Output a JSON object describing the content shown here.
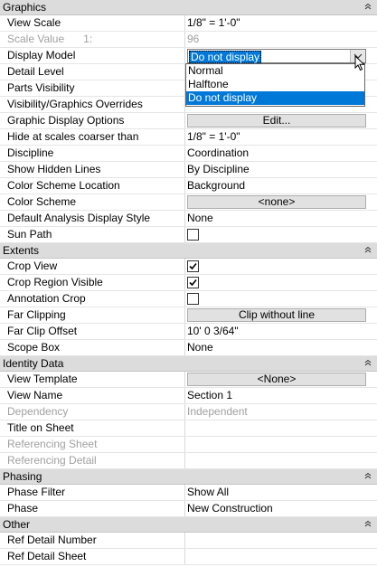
{
  "sections": [
    {
      "title": "Graphics",
      "rows": [
        {
          "name": "View Scale",
          "value": "1/8\" = 1'-0\""
        },
        {
          "name": "Scale Value",
          "extra": "1:",
          "value": "96",
          "disabled": true
        },
        {
          "name": "Display Model",
          "type": "combo",
          "value": "Do not display"
        },
        {
          "name": "Detail Level",
          "value": ""
        },
        {
          "name": "Parts Visibility",
          "value": ""
        },
        {
          "name": "Visibility/Graphics Overrides",
          "value": ""
        },
        {
          "name": "Graphic Display Options",
          "type": "button",
          "value": "Edit..."
        },
        {
          "name": "Hide at scales coarser than",
          "value": "1/8\" = 1'-0\""
        },
        {
          "name": "Discipline",
          "value": "Coordination"
        },
        {
          "name": "Show Hidden Lines",
          "value": "By Discipline"
        },
        {
          "name": "Color Scheme Location",
          "value": "Background"
        },
        {
          "name": "Color Scheme",
          "type": "button",
          "value": "<none>"
        },
        {
          "name": "Default Analysis Display Style",
          "value": "None"
        },
        {
          "name": "Sun Path",
          "type": "checkbox",
          "checked": false
        }
      ]
    },
    {
      "title": "Extents",
      "rows": [
        {
          "name": "Crop View",
          "type": "checkbox",
          "checked": true
        },
        {
          "name": "Crop Region Visible",
          "type": "checkbox",
          "checked": true
        },
        {
          "name": "Annotation Crop",
          "type": "checkbox",
          "checked": false
        },
        {
          "name": "Far Clipping",
          "type": "button",
          "value": "Clip without line"
        },
        {
          "name": "Far Clip Offset",
          "value": "10'  0 3/64\""
        },
        {
          "name": "Scope Box",
          "value": "None"
        }
      ]
    },
    {
      "title": "Identity Data",
      "rows": [
        {
          "name": "View Template",
          "type": "button",
          "value": "<None>"
        },
        {
          "name": "View Name",
          "value": "Section 1"
        },
        {
          "name": "Dependency",
          "value": "Independent",
          "disabled": true
        },
        {
          "name": "Title on Sheet",
          "value": ""
        },
        {
          "name": "Referencing Sheet",
          "value": "",
          "disabled": true
        },
        {
          "name": "Referencing Detail",
          "value": "",
          "disabled": true
        }
      ]
    },
    {
      "title": "Phasing",
      "rows": [
        {
          "name": "Phase Filter",
          "value": "Show All"
        },
        {
          "name": "Phase",
          "value": "New Construction"
        }
      ]
    },
    {
      "title": "Other",
      "rows": [
        {
          "name": "Ref Detail Number",
          "value": ""
        },
        {
          "name": "Ref Detail Sheet",
          "value": ""
        }
      ]
    }
  ],
  "dropdown": {
    "options": [
      "Normal",
      "Halftone",
      "Do not display"
    ],
    "highlighted": "Do not display"
  },
  "icons": {
    "collapse": "collapse-chevron-up-icon",
    "dropdown": "chevron-down-icon",
    "checkmark": "checkmark-icon",
    "cursor": "mouse-pointer-icon"
  },
  "colors": {
    "section_bg": "#dcdcdc",
    "selection": "#0078d7",
    "disabled_text": "#a0a0a0"
  }
}
